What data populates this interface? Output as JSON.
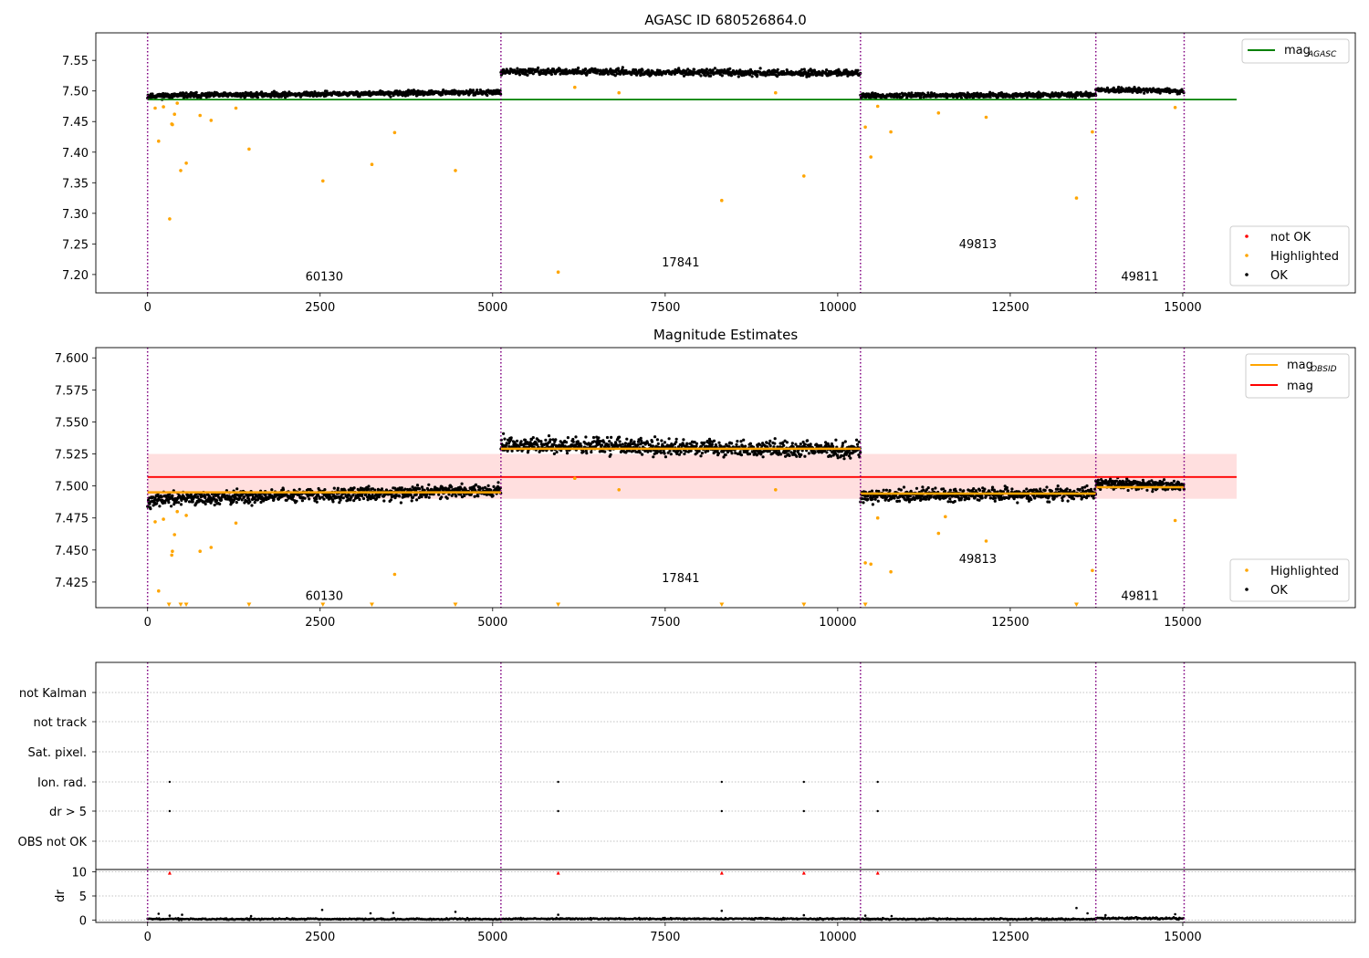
{
  "chart_data": [
    {
      "type": "scatter",
      "title": "AGASC ID 680526864.0",
      "xlim": [
        -750,
        17500
      ],
      "ylim": [
        7.17,
        7.595
      ],
      "x_ticks": [
        0,
        2500,
        5000,
        7500,
        10000,
        12500,
        15000
      ],
      "x_tick_labels": [
        "0",
        "2500",
        "5000",
        "7500",
        "10000",
        "12500",
        "15000"
      ],
      "y_ticks": [
        7.2,
        7.25,
        7.3,
        7.35,
        7.4,
        7.45,
        7.5,
        7.55
      ],
      "y_tick_labels": [
        "7.20",
        "7.25",
        "7.30",
        "7.35",
        "7.40",
        "7.45",
        "7.50",
        "7.55"
      ],
      "obs_boundaries": [
        0,
        5120,
        10330,
        13740,
        15020
      ],
      "obs_labels": [
        {
          "text": "60130",
          "x": 2560,
          "y": 7.19
        },
        {
          "text": "17841",
          "x": 7725,
          "y": 7.213
        },
        {
          "text": "49813",
          "x": 12030,
          "y": 7.243
        },
        {
          "text": "49811",
          "x": 14380,
          "y": 7.19
        }
      ],
      "segments": [
        {
          "x0": 0,
          "x1": 5120,
          "y_start": 7.492,
          "y_end": 7.498,
          "spread": 0.004
        },
        {
          "x0": 5120,
          "x1": 10330,
          "y_start": 7.532,
          "y_end": 7.529,
          "spread": 0.005
        },
        {
          "x0": 10330,
          "x1": 13740,
          "y_start": 7.492,
          "y_end": 7.494,
          "spread": 0.004
        },
        {
          "x0": 13740,
          "x1": 15020,
          "y_start": 7.502,
          "y_end": 7.5,
          "spread": 0.004
        }
      ],
      "reference_line": {
        "name": "mag_AGASC",
        "y": 7.486,
        "x0": 0,
        "x1": 15780,
        "color": "#008000"
      },
      "highlighted_points": [
        [
          110,
          7.472
        ],
        [
          160,
          7.418
        ],
        [
          230,
          7.474
        ],
        [
          320,
          7.291
        ],
        [
          350,
          7.446
        ],
        [
          360,
          7.445
        ],
        [
          390,
          7.462
        ],
        [
          430,
          7.48
        ],
        [
          480,
          7.37
        ],
        [
          560,
          7.382
        ],
        [
          760,
          7.46
        ],
        [
          920,
          7.452
        ],
        [
          1280,
          7.472
        ],
        [
          1470,
          7.405
        ],
        [
          2540,
          7.353
        ],
        [
          3250,
          7.38
        ],
        [
          3580,
          7.432
        ],
        [
          4460,
          7.37
        ],
        [
          5950,
          7.204
        ],
        [
          6190,
          7.506
        ],
        [
          6830,
          7.497
        ],
        [
          8320,
          7.321
        ],
        [
          9100,
          7.497
        ],
        [
          9510,
          7.361
        ],
        [
          10400,
          7.441
        ],
        [
          10480,
          7.392
        ],
        [
          10580,
          7.475
        ],
        [
          10770,
          7.433
        ],
        [
          11460,
          7.464
        ],
        [
          12150,
          7.457
        ],
        [
          13460,
          7.325
        ],
        [
          13690,
          7.433
        ],
        [
          14890,
          7.473
        ]
      ],
      "legends": [
        {
          "entries": [
            {
              "label": "mag",
              "subscript": "AGASC",
              "kind": "line",
              "color": "#008000"
            }
          ],
          "position": "upper right"
        },
        {
          "entries": [
            {
              "label": "not OK",
              "kind": "marker",
              "color": "#ff0000"
            },
            {
              "label": "Highlighted",
              "kind": "marker",
              "color": "#ffa500"
            },
            {
              "label": "OK",
              "kind": "marker",
              "color": "#000000"
            }
          ],
          "position": "lower right"
        }
      ]
    },
    {
      "type": "scatter",
      "title": "Magnitude Estimates",
      "xlim": [
        -750,
        17500
      ],
      "ylim": [
        7.405,
        7.608
      ],
      "x_ticks": [
        0,
        2500,
        5000,
        7500,
        10000,
        12500,
        15000
      ],
      "x_tick_labels": [
        "0",
        "2500",
        "5000",
        "7500",
        "10000",
        "12500",
        "15000"
      ],
      "y_ticks": [
        7.425,
        7.45,
        7.475,
        7.5,
        7.525,
        7.55,
        7.575,
        7.6
      ],
      "y_tick_labels": [
        "7.425",
        "7.450",
        "7.475",
        "7.500",
        "7.525",
        "7.550",
        "7.575",
        "7.600"
      ],
      "obs_boundaries": [
        0,
        5120,
        10330,
        13740,
        15020
      ],
      "obs_labels": [
        {
          "text": "60130",
          "x": 2560,
          "y": 7.411
        },
        {
          "text": "17841",
          "x": 7725,
          "y": 7.425
        },
        {
          "text": "49813",
          "x": 12030,
          "y": 7.44
        },
        {
          "text": "49811",
          "x": 14380,
          "y": 7.411
        }
      ],
      "segments": [
        {
          "x0": 0,
          "x1": 5120,
          "y_start": 7.489,
          "y_end": 7.497,
          "spread": 0.005
        },
        {
          "x0": 5120,
          "x1": 10330,
          "y_start": 7.532,
          "y_end": 7.528,
          "spread": 0.006
        },
        {
          "x0": 10330,
          "x1": 13740,
          "y_start": 7.492,
          "y_end": 7.494,
          "spread": 0.005
        },
        {
          "x0": 13740,
          "x1": 15020,
          "y_start": 7.502,
          "y_end": 7.5,
          "spread": 0.004
        }
      ],
      "obsid_means": [
        {
          "x0": 0,
          "x1": 5120,
          "y": 7.495
        },
        {
          "x0": 5120,
          "x1": 10330,
          "y": 7.529
        },
        {
          "x0": 10330,
          "x1": 13740,
          "y": 7.494
        },
        {
          "x0": 13740,
          "x1": 15020,
          "y": 7.499
        }
      ],
      "mean_line": {
        "name": "mag",
        "y": 7.507,
        "x0": 0,
        "x1": 15780,
        "color": "#ff0000"
      },
      "band": {
        "y0": 7.49,
        "y1": 7.525,
        "x0": 0,
        "x1": 15780,
        "color": "#ffc0c0"
      },
      "highlighted_points": [
        [
          110,
          7.472
        ],
        [
          160,
          7.418
        ],
        [
          230,
          7.474
        ],
        [
          350,
          7.446
        ],
        [
          360,
          7.449
        ],
        [
          390,
          7.462
        ],
        [
          430,
          7.48
        ],
        [
          560,
          7.477
        ],
        [
          760,
          7.449
        ],
        [
          920,
          7.452
        ],
        [
          1280,
          7.471
        ],
        [
          3580,
          7.431
        ],
        [
          6190,
          7.506
        ],
        [
          6830,
          7.497
        ],
        [
          9100,
          7.497
        ],
        [
          10400,
          7.44
        ],
        [
          10480,
          7.439
        ],
        [
          10580,
          7.475
        ],
        [
          10770,
          7.433
        ],
        [
          11460,
          7.463
        ],
        [
          11560,
          7.476
        ],
        [
          12150,
          7.457
        ],
        [
          13690,
          7.434
        ],
        [
          14890,
          7.473
        ]
      ],
      "below_range_markers": [
        310,
        480,
        560,
        1470,
        2540,
        3250,
        4460,
        5950,
        8320,
        9510,
        10400,
        13460
      ],
      "legends": [
        {
          "entries": [
            {
              "label": "mag",
              "subscript": "OBSID",
              "kind": "line",
              "color": "#ffa500"
            },
            {
              "label": "mag",
              "kind": "line",
              "color": "#ff0000"
            }
          ],
          "position": "upper right"
        },
        {
          "entries": [
            {
              "label": "Highlighted",
              "kind": "marker",
              "color": "#ffa500"
            },
            {
              "label": "OK",
              "kind": "marker",
              "color": "#000000"
            }
          ],
          "position": "lower right"
        }
      ]
    },
    {
      "type": "scatter",
      "title": "",
      "xlim": [
        -750,
        17500
      ],
      "x_ticks": [
        0,
        2500,
        5000,
        7500,
        10000,
        12500,
        15000
      ],
      "x_tick_labels": [
        "0",
        "2500",
        "5000",
        "7500",
        "10000",
        "12500",
        "15000"
      ],
      "obs_boundaries": [
        0,
        5120,
        10330,
        13740,
        15020
      ],
      "flag_rows": [
        "not Kalman",
        "not track",
        "Sat. pixel.",
        "Ion. rad.",
        "dr > 5",
        "OBS not OK"
      ],
      "flag_points": [
        {
          "row": "Ion. rad.",
          "x": [
            320,
            5950,
            8320,
            9510,
            10580
          ]
        },
        {
          "row": "dr > 5",
          "x": [
            320,
            5950,
            8320,
            9510,
            10580
          ]
        }
      ],
      "dr_panel": {
        "ylabel": "dr",
        "ylim": [
          -0.5,
          10.5
        ],
        "y_ticks": [
          0,
          5,
          10
        ],
        "y_tick_labels": [
          "0",
          "5",
          "10"
        ],
        "clipped_markers": [
          320,
          5950,
          8320,
          9510,
          10580
        ],
        "scattered_points": [
          [
            160,
            1.3
          ],
          [
            320,
            0.9
          ],
          [
            500,
            1.1
          ],
          [
            1500,
            0.8
          ],
          [
            2530,
            2.1
          ],
          [
            3230,
            1.4
          ],
          [
            3560,
            1.5
          ],
          [
            4460,
            1.7
          ],
          [
            5950,
            1.1
          ],
          [
            8320,
            1.9
          ],
          [
            9510,
            1.0
          ],
          [
            10400,
            0.9
          ],
          [
            10780,
            0.8
          ],
          [
            13460,
            2.5
          ],
          [
            13620,
            1.4
          ],
          [
            13880,
            1.0
          ],
          [
            14890,
            1.2
          ]
        ],
        "segments": [
          {
            "x0": 0,
            "x1": 5120,
            "y_start": 0.2,
            "y_end": 0.2,
            "spread": 0.15
          },
          {
            "x0": 5120,
            "x1": 10330,
            "y_start": 0.25,
            "y_end": 0.25,
            "spread": 0.15
          },
          {
            "x0": 10330,
            "x1": 13740,
            "y_start": 0.2,
            "y_end": 0.2,
            "spread": 0.15
          },
          {
            "x0": 13740,
            "x1": 15020,
            "y_start": 0.35,
            "y_end": 0.35,
            "spread": 0.2
          }
        ]
      }
    }
  ]
}
